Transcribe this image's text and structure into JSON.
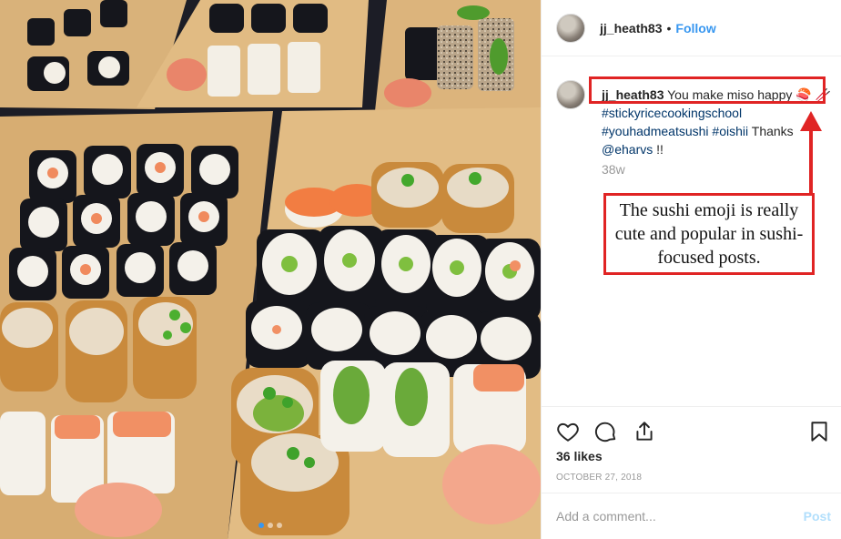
{
  "post": {
    "username": "jj_heath83",
    "follow_label": "Follow",
    "dot": "•"
  },
  "caption": {
    "username": "jj_heath83",
    "text": "You make miso happy",
    "emoji": "🍣",
    "hashtags": [
      "#stickyricecookingschool",
      "#youhadmeatsushi",
      "#oishii"
    ],
    "thanks": "Thanks",
    "mention": "@eharvs",
    "ending": "!!",
    "time_ago": "38w"
  },
  "annotation": {
    "text": "The sushi emoji is really cute and popular in sushi-focused posts.",
    "color": "#e02424"
  },
  "actions": {
    "likes": "36 likes",
    "date": "OCTOBER 27, 2018",
    "icons": [
      "heart-icon",
      "comment-icon",
      "share-icon",
      "bookmark-icon"
    ]
  },
  "add_comment": {
    "placeholder": "Add a comment...",
    "post_label": "Post"
  },
  "carousel": {
    "count": 3,
    "active": 0
  },
  "colors": {
    "link": "#3897f0",
    "hashtag": "#003569",
    "muted": "#999999"
  }
}
